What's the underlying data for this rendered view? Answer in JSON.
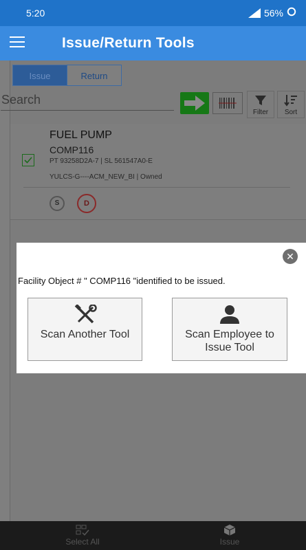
{
  "status_bar": {
    "time": "5:20",
    "battery": "56%"
  },
  "app_bar": {
    "title": "Issue/Return Tools"
  },
  "tabs": [
    {
      "label": "Issue",
      "active": true
    },
    {
      "label": "Return",
      "active": false
    }
  ],
  "search": {
    "placeholder": "Search"
  },
  "toolbar": {
    "filter_label": "Filter",
    "sort_label": "Sort"
  },
  "item": {
    "name": "FUEL PUMP",
    "code": "COMP116",
    "part_serial": "PT 93258D2A-7 | SL 561547A0-E",
    "location": "YULCS-G----ACM_NEW_BI | Owned",
    "badge_s": "S",
    "badge_d": "D"
  },
  "dialog": {
    "message": "Facility Object # \" COMP116 \"identified to be issued.",
    "option_1": "Scan Another Tool",
    "option_2": "Scan Employee to Issue Tool"
  },
  "bottom_nav": {
    "select_all": "Select All",
    "issue": "Issue"
  },
  "colors": {
    "status_bar": "#1f73c9",
    "app_bar": "#3a8be0",
    "go_button": "#167816"
  }
}
